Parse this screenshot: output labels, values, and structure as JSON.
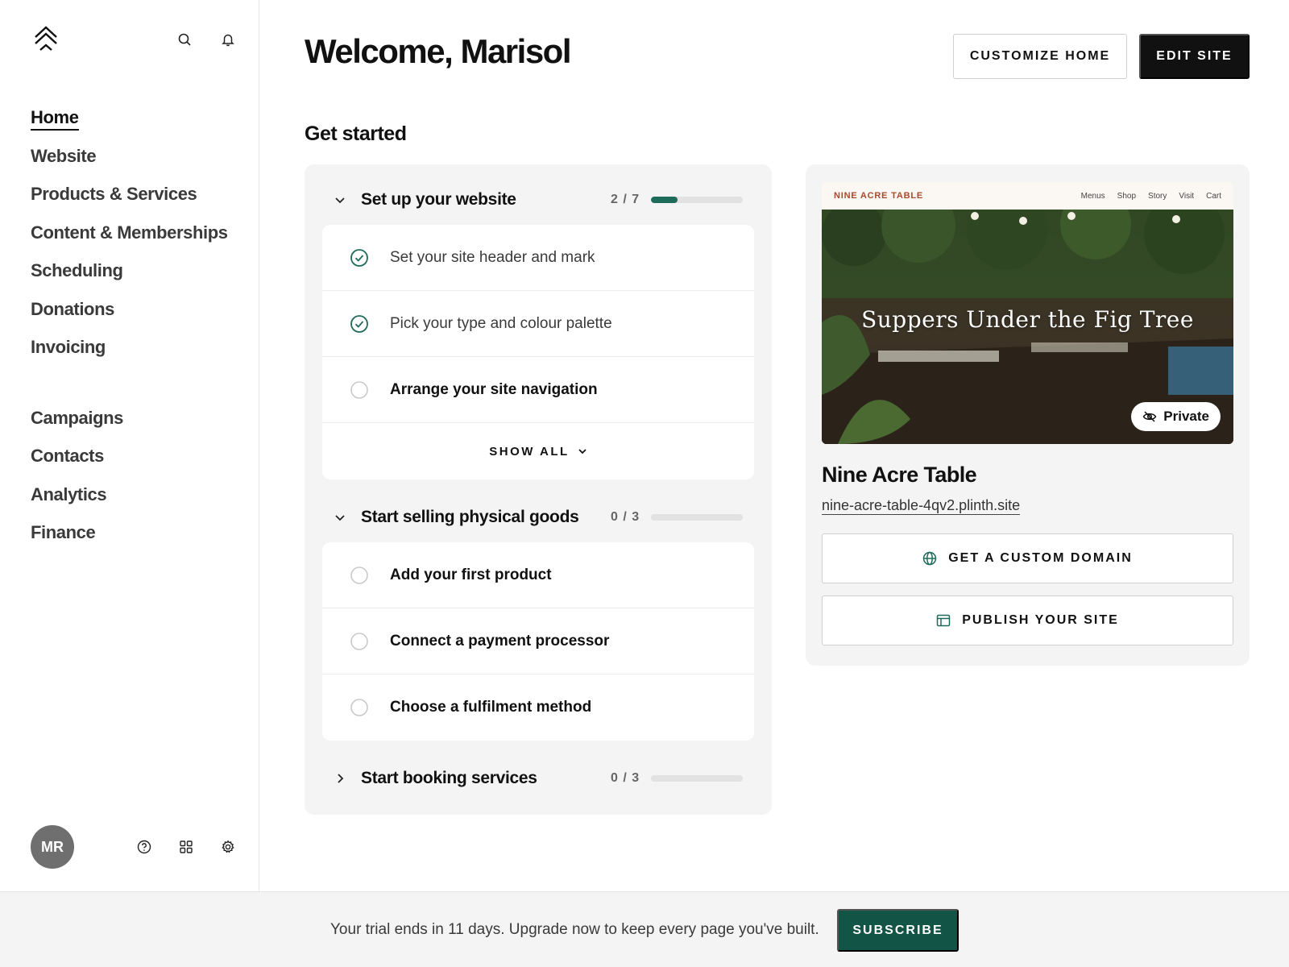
{
  "sidebar": {
    "logo_icon": "layered-chevrons-logo",
    "top_icons": [
      "search-icon",
      "bell-icon"
    ],
    "nav_primary": [
      {
        "label": "Home",
        "active": true
      },
      {
        "label": "Website"
      },
      {
        "label": "Products & Services"
      },
      {
        "label": "Content & Memberships"
      },
      {
        "label": "Scheduling"
      },
      {
        "label": "Donations"
      },
      {
        "label": "Invoicing"
      }
    ],
    "nav_secondary": [
      {
        "label": "Campaigns"
      },
      {
        "label": "Contacts"
      },
      {
        "label": "Analytics"
      },
      {
        "label": "Finance"
      }
    ],
    "avatar_initials": "MR",
    "bottom_icons": [
      "help-icon",
      "apps-grid-icon",
      "settings-gear-icon"
    ]
  },
  "header": {
    "welcome": "Welcome, Marisol",
    "customize_label": "CUSTOMIZE HOME",
    "edit_label": "EDIT SITE"
  },
  "get_started": {
    "title": "Get started",
    "groups": [
      {
        "title": "Set up your website",
        "count": "2 / 7",
        "progress": 0.2857,
        "expanded": true,
        "tasks": [
          {
            "label": "Set your site header and mark",
            "done": true
          },
          {
            "label": "Pick your type and colour palette",
            "done": true
          },
          {
            "label": "Arrange your site navigation",
            "done": false
          }
        ],
        "show_all_label": "SHOW ALL"
      },
      {
        "title": "Start selling physical goods",
        "count": "0 / 3",
        "progress": 0,
        "expanded": true,
        "tasks": [
          {
            "label": "Add your first product",
            "done": false
          },
          {
            "label": "Connect a payment processor",
            "done": false
          },
          {
            "label": "Choose a fulfilment method",
            "done": false
          }
        ]
      },
      {
        "title": "Start booking services",
        "count": "0 / 3",
        "progress": 0,
        "expanded": false
      }
    ]
  },
  "site": {
    "preview_brand": "NINE ACRE TABLE",
    "preview_links": [
      "Menus",
      "Shop",
      "Story",
      "Visit",
      "Cart"
    ],
    "preview_headline": "Suppers Under the Fig Tree",
    "private_label": "Private",
    "name": "Nine Acre Table",
    "url": "nine-acre-table-4qv2.plinth.site",
    "domain_button": "GET A CUSTOM DOMAIN",
    "publish_button": "PUBLISH YOUR SITE"
  },
  "banner": {
    "text": "Your trial ends in 11 days. Upgrade now to keep every page you've built.",
    "subscribe_label": "SUBSCRIBE"
  },
  "colors": {
    "accent": "#1e6b5c",
    "subscribe": "#125446",
    "brand_red": "#a8492c"
  }
}
